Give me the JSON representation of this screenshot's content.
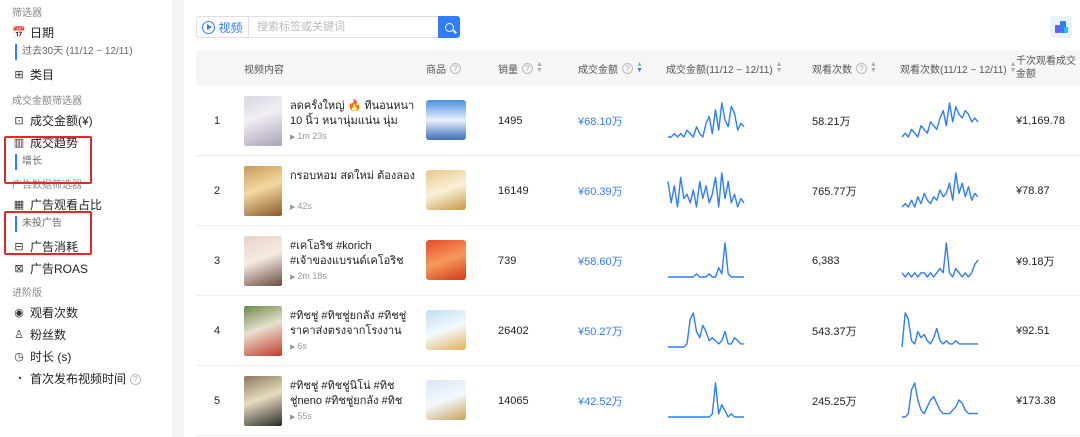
{
  "sidebar": {
    "section1_title": "筛选器",
    "date_label": "日期",
    "date_value": "过去30天 (11/12 ~ 12/11)",
    "category_label": "类目",
    "section2_title": "成交金额筛选器",
    "gmv_label": "成交金额(¥)",
    "trend_label": "成交趋势",
    "trend_value": "增长",
    "section3_title": "广告数据筛选器",
    "ad_view_label": "广告观看占比",
    "ad_view_value": "未投广告",
    "ad_spend_label": "广告消耗",
    "ad_roas_label": "广告ROAS",
    "section4_title": "进阶版",
    "views_label": "观看次数",
    "fans_label": "粉丝数",
    "duration_label": "时长 (s)",
    "first_post_label": "首次发布视频时间"
  },
  "search": {
    "tag_label": "视频",
    "placeholder": "搜索标签或关键词"
  },
  "table": {
    "headers": {
      "video": "视频内容",
      "product": "商品",
      "sales": "销量",
      "gmv": "成交金额",
      "gmv_trend": "成交金额(11/12 ~ 12/11)",
      "views": "观看次数",
      "views_trend": "观看次数(11/12 ~ 12/11)",
      "cpm": "千次观看成交金额"
    },
    "rows": [
      {
        "index": "1",
        "title": "ลดครั้งใหญ่ 🔥 ที่นอนหนา 10 นิ้ว หนานุ่มแน่น นุ่มเด้ง...",
        "duration": "1m 23s",
        "sales": "1495",
        "gmv": "¥68.10万",
        "views": "58.21万",
        "cpm": "¥1,169.78",
        "gmv_trend": [
          2,
          2,
          3,
          2,
          3,
          2,
          4,
          3,
          2,
          5,
          3,
          2,
          6,
          8,
          3,
          10,
          4,
          12,
          7,
          5,
          11,
          9,
          4,
          6,
          5
        ],
        "views_trend": [
          2,
          3,
          2,
          4,
          3,
          2,
          5,
          4,
          3,
          6,
          5,
          4,
          7,
          9,
          5,
          11,
          6,
          10,
          8,
          7,
          9,
          8,
          6,
          7,
          6
        ]
      },
      {
        "index": "2",
        "title": "กรอบหอม สดใหม่ ต้องลอง",
        "duration": "42s",
        "sales": "16149",
        "gmv": "¥60.39万",
        "views": "765.77万",
        "cpm": "¥78.87",
        "gmv_trend": [
          9,
          4,
          8,
          3,
          10,
          5,
          6,
          4,
          7,
          3,
          9,
          5,
          8,
          4,
          6,
          10,
          3,
          11,
          5,
          9,
          4,
          6,
          3,
          5,
          4
        ],
        "views_trend": [
          2,
          3,
          2,
          4,
          2,
          5,
          3,
          6,
          4,
          3,
          5,
          4,
          7,
          5,
          6,
          9,
          4,
          12,
          6,
          9,
          5,
          8,
          4,
          6,
          5
        ]
      },
      {
        "index": "3",
        "title": "#เคโอริช #korich #เจ้าของแบรนด์เคโอริช",
        "duration": "2m 18s",
        "sales": "739",
        "gmv": "¥58.60万",
        "views": "6,383",
        "cpm": "¥9.18万",
        "gmv_trend": [
          1,
          1,
          1,
          1,
          1,
          1,
          1,
          1,
          1,
          2,
          1,
          1,
          1,
          2,
          1,
          1,
          4,
          2,
          12,
          2,
          1,
          1,
          1,
          1,
          1
        ],
        "views_trend": [
          3,
          2,
          3,
          2,
          3,
          2,
          3,
          3,
          2,
          3,
          2,
          3,
          4,
          3,
          10,
          3,
          2,
          4,
          3,
          2,
          3,
          2,
          3,
          5,
          6
        ]
      },
      {
        "index": "4",
        "title": "#ทิชชู่ #ทิชชู่ยกลัง #ทิชชู่ราคาส่งตรงจากโรงงาน #ทิ...",
        "duration": "6s",
        "sales": "26402",
        "gmv": "¥50.27万",
        "views": "543.37万",
        "cpm": "¥92.51",
        "gmv_trend": [
          1,
          1,
          1,
          1,
          1,
          1,
          2,
          10,
          12,
          6,
          4,
          8,
          6,
          3,
          4,
          3,
          2,
          3,
          6,
          2,
          2,
          4,
          3,
          2,
          2
        ],
        "views_trend": [
          1,
          12,
          10,
          3,
          2,
          6,
          4,
          5,
          3,
          2,
          4,
          7,
          3,
          2,
          3,
          2,
          2,
          3,
          2,
          2,
          2,
          2,
          2,
          2,
          2
        ]
      },
      {
        "index": "5",
        "title": "#ทิชชู่ #ทิชชู่นิโน่ #ทิชชู่neno #ทิชชู่ยกลัง #ทิชชู่...",
        "duration": "55s",
        "sales": "14065",
        "gmv": "¥42.52万",
        "views": "245.25万",
        "cpm": "¥173.38",
        "gmv_trend": [
          1,
          1,
          1,
          1,
          1,
          1,
          1,
          1,
          1,
          1,
          1,
          1,
          1,
          1,
          2,
          12,
          2,
          5,
          3,
          1,
          2,
          1,
          1,
          1,
          1
        ],
        "views_trend": [
          1,
          1,
          2,
          9,
          11,
          6,
          3,
          2,
          4,
          6,
          7,
          5,
          3,
          2,
          2,
          2,
          3,
          4,
          6,
          5,
          3,
          2,
          2,
          2,
          2
        ]
      }
    ]
  },
  "colors": {
    "accent": "#2f7ef7",
    "highlight_box": "#e02a2a"
  },
  "icons": {
    "date": "calendar-icon",
    "category": "grid-icon",
    "gmv": "yuan-icon",
    "trend": "bar-chart-icon",
    "ad_view": "ad-chart-icon",
    "ad_spend": "receipt-icon",
    "ad_roas": "roas-icon",
    "views": "eye-icon",
    "fans": "user-icon",
    "duration": "timer-icon",
    "first_post": "clock-icon",
    "search": "magnifier-icon"
  }
}
